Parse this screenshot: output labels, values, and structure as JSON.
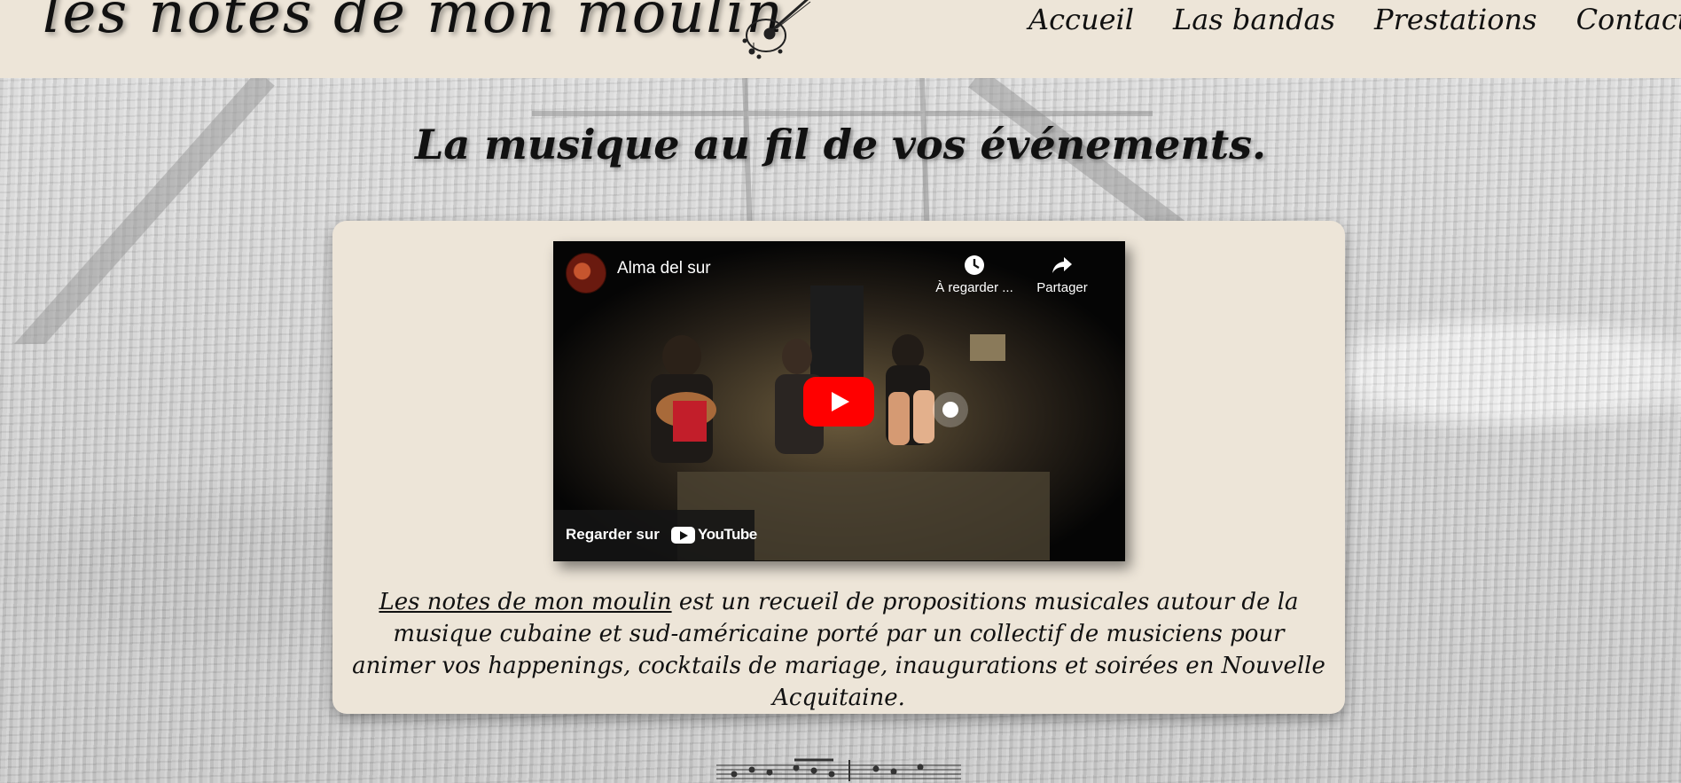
{
  "site": {
    "logo_text": "les notes de mon moulin",
    "logo_icon": "guitar-notes-icon"
  },
  "nav": {
    "items": [
      {
        "label": "Accueil"
      },
      {
        "label": "Las bandas"
      },
      {
        "label": "Prestations"
      },
      {
        "label": "Contact"
      }
    ]
  },
  "hero": {
    "tagline": "La musique au fil de vos événements."
  },
  "video": {
    "channel_title": "Alma del sur",
    "watch_later_label": "À regarder ...",
    "share_label": "Partager",
    "watch_on_label": "Regarder sur",
    "platform_name": "YouTube",
    "play_color": "#ff0000"
  },
  "description": {
    "brand_link": "Les notes de mon moulin",
    "text": " est un recueil de propositions musicales autour de la musique cubaine et sud-américaine porté par un collectif de musiciens pour animer vos happenings, cocktails de mariage, inaugurations et soirées en Nouvelle Acquitaine."
  },
  "colors": {
    "panel_background": "#ede5d8",
    "text": "#111111"
  }
}
